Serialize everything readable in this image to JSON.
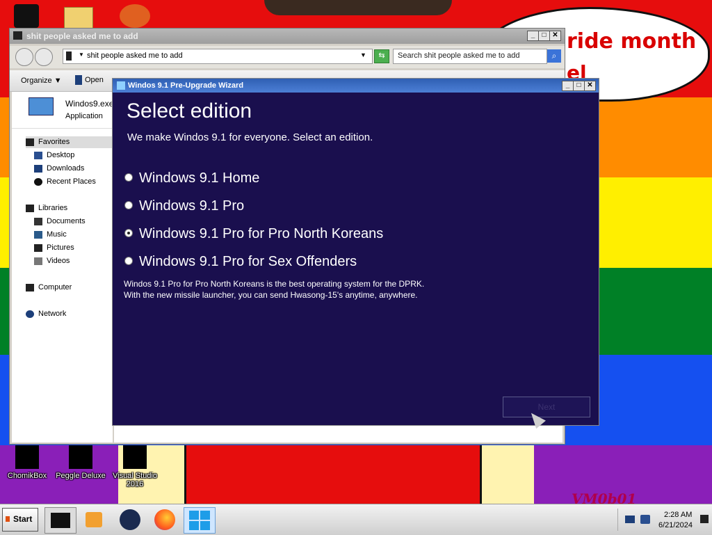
{
  "colors": {
    "stripe_red": "#e60d0d",
    "stripe_orange": "#ff8c00",
    "stripe_yellow": "#ffef00",
    "stripe_green": "#008026",
    "stripe_blue": "#1550f0",
    "stripe_purple": "#8a1fb8",
    "wizard_bg": "#1a0f4e",
    "wizard_title": "#3b6cc4"
  },
  "wallpaper": {
    "bubble_line1": "ride month",
    "bubble_line2": "el",
    "signature": "VM0b01"
  },
  "desktop_icons": [
    {
      "label": "ChomikBox"
    },
    {
      "label": "Peggle Deluxe"
    },
    {
      "label": "Visual Studio 2016"
    }
  ],
  "explorer": {
    "title": "shit people asked me to add",
    "address": "shit people asked me to add",
    "search_placeholder": "Search shit people asked me to add",
    "toolbar": {
      "organize": "Organize",
      "open": "Open"
    },
    "file": {
      "name": "Windos9.exe",
      "type": "Application"
    },
    "sidebar": {
      "favorites": "Favorites",
      "desktop": "Desktop",
      "downloads": "Downloads",
      "recent": "Recent Places",
      "libraries": "Libraries",
      "documents": "Documents",
      "music": "Music",
      "pictures": "Pictures",
      "videos": "Videos",
      "computer": "Computer",
      "network": "Network"
    }
  },
  "wizard": {
    "title": "Windos 9.1 Pre-Upgrade Wizard",
    "heading": "Select edition",
    "subheading": "We make Windos 9.1 for everyone. Select an edition.",
    "options": [
      {
        "label": "Windows 9.1 Home",
        "selected": false
      },
      {
        "label": "Windows 9.1 Pro",
        "selected": false
      },
      {
        "label": "Windows 9.1 Pro for Pro North Koreans",
        "selected": true
      },
      {
        "label": "Windows 9.1 Pro for Sex Offenders",
        "selected": false
      }
    ],
    "description_line1": "Windos 9.1 Pro for Pro North Koreans is the best operating system for the DPRK.",
    "description_line2": "With the new missile launcher, you can send Hwasong-15's anytime, anywhere.",
    "next_label": "Next"
  },
  "taskbar": {
    "start_label": "Start",
    "time": "2:28 AM",
    "date": "6/21/2024"
  }
}
